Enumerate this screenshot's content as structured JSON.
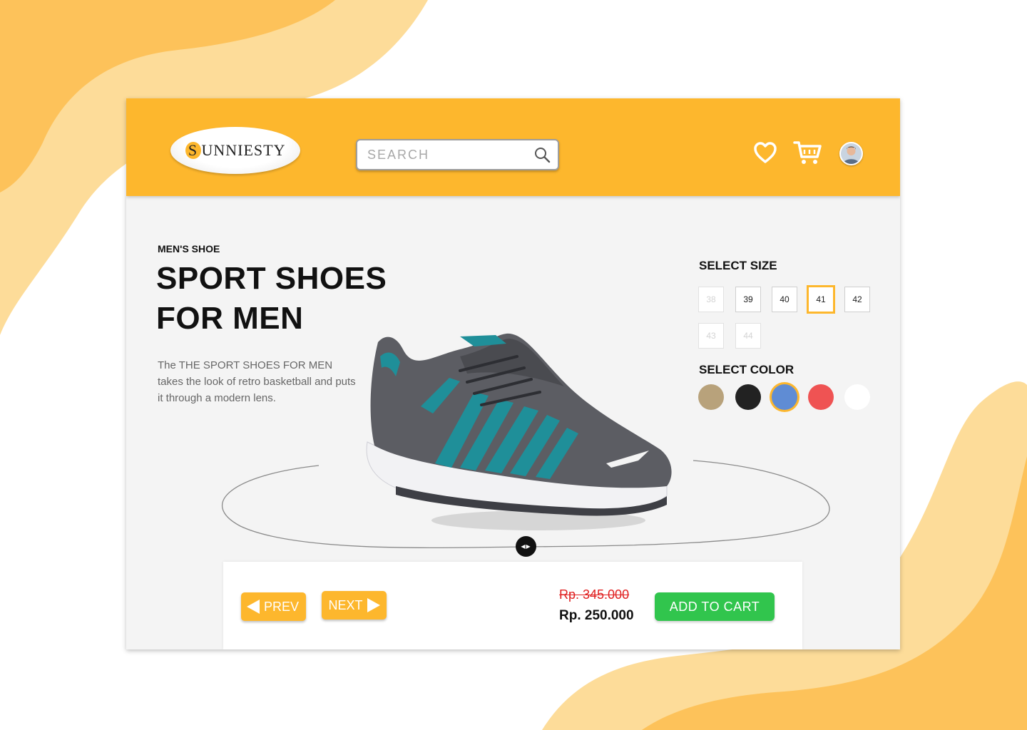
{
  "brand": {
    "logo_first_letter": "S",
    "logo_rest": "UNNIESTY"
  },
  "search": {
    "placeholder": "SEARCH",
    "value": ""
  },
  "header_icons": [
    "heart-icon",
    "cart-icon",
    "user-avatar"
  ],
  "product": {
    "category": "MEN'S SHOE",
    "title_line1": "SPORT SHOES",
    "title_line2": "FOR MEN",
    "description": "The THE SPORT SHOES FOR MEN takes the look of retro basketball and puts it through a modern lens."
  },
  "size": {
    "label": "SELECT SIZE",
    "options": [
      {
        "value": "38",
        "available": false
      },
      {
        "value": "39",
        "available": true
      },
      {
        "value": "40",
        "available": true
      },
      {
        "value": "41",
        "available": true,
        "selected": true
      },
      {
        "value": "42",
        "available": true
      },
      {
        "value": "43",
        "available": false
      },
      {
        "value": "44",
        "available": false
      }
    ]
  },
  "color": {
    "label": "SELECT COLOR",
    "options": [
      {
        "name": "tan",
        "hex": "#b8a27b"
      },
      {
        "name": "black",
        "hex": "#222222"
      },
      {
        "name": "blue",
        "hex": "#5f8cd4",
        "selected": true
      },
      {
        "name": "red",
        "hex": "#ef5353"
      },
      {
        "name": "white",
        "hex": "#ffffff"
      }
    ]
  },
  "navigation": {
    "prev_label": "PREV",
    "next_label": "NEXT"
  },
  "pricing": {
    "old_price": "Rp. 345.000",
    "new_price": "Rp. 250.000",
    "add_to_cart_label": "ADD TO CART"
  },
  "theme": {
    "accent": "#fdb72d",
    "cta_green": "#31c54d",
    "strike_red": "#e02020"
  }
}
